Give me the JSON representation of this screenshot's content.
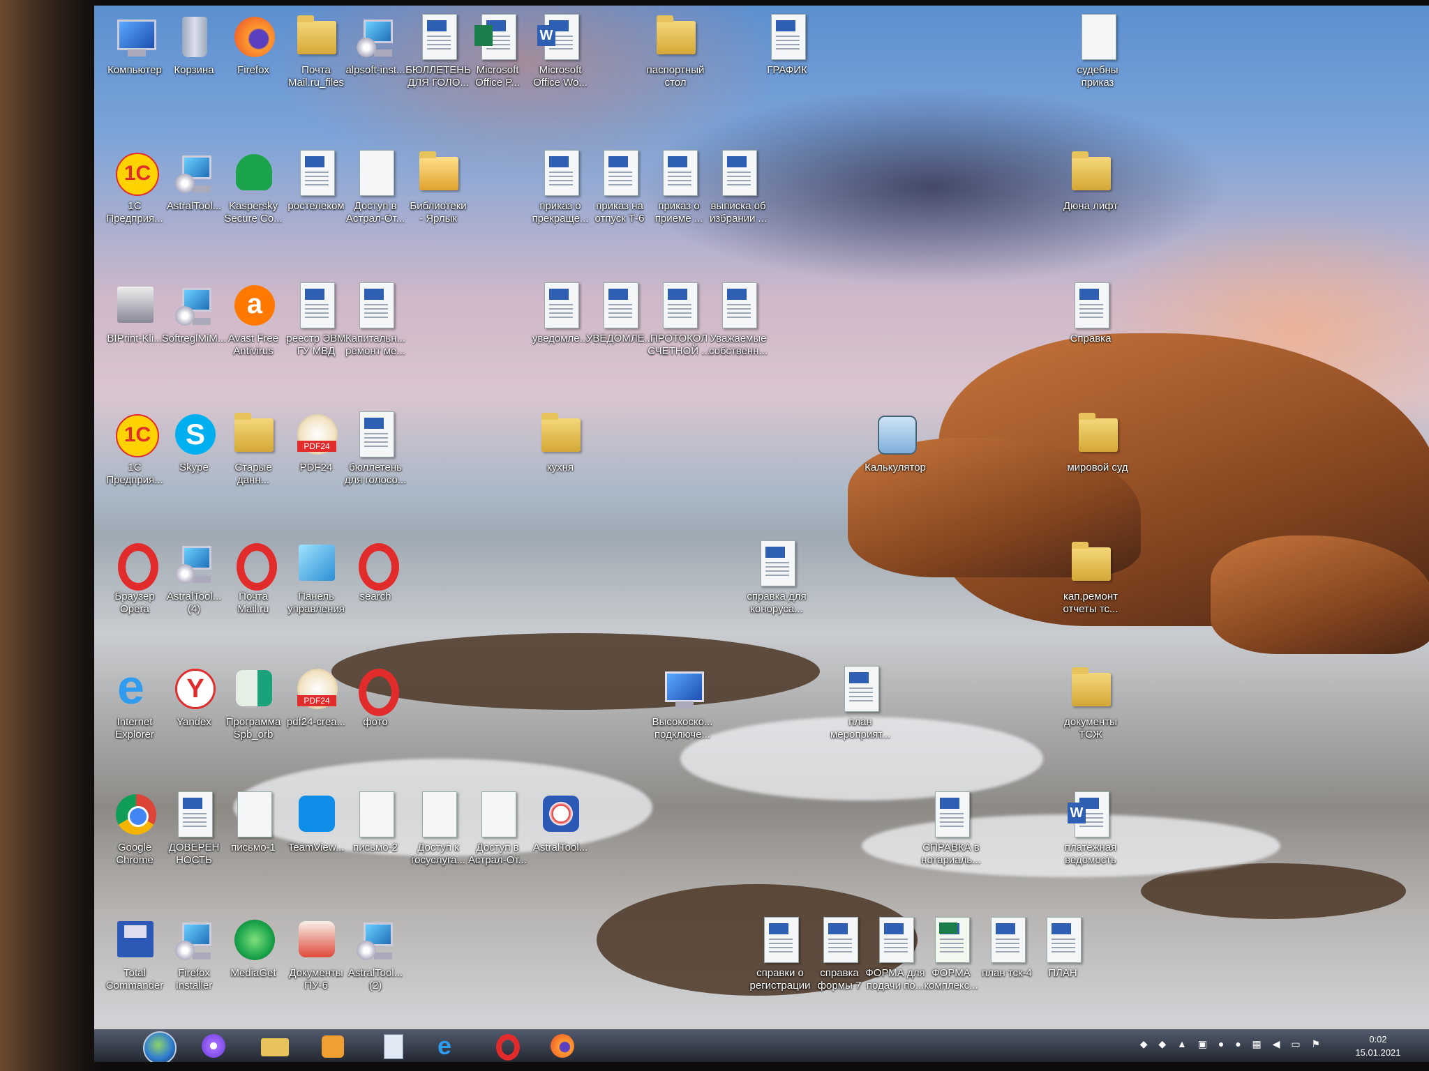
{
  "desktop_icons": [
    {
      "label": "Компьютер",
      "icon": "computer-icon"
    },
    {
      "label": "Корзина",
      "icon": "recycle-bin-icon"
    },
    {
      "label": "Firefox",
      "icon": "firefox-icon"
    },
    {
      "label": "Почта\nMail.ru_files",
      "icon": "folder-icon"
    },
    {
      "label": "alpsoft-inst...",
      "icon": "installer-icon"
    },
    {
      "label": "БЮЛЛЕТЕНЬ\nДЛЯ ГОЛО...",
      "icon": "word-doc-icon"
    },
    {
      "label": "Microsoft\nOffice P...",
      "icon": "publisher-icon"
    },
    {
      "label": "Microsoft\nOffice Wo...",
      "icon": "word-icon"
    },
    {
      "label": "паспортный\nстол",
      "icon": "folder-icon"
    },
    {
      "label": "ГРАФИК",
      "icon": "word-doc-icon"
    },
    {
      "label": "судебны\nприказ",
      "icon": "document-icon"
    },
    {
      "label": "1С\nПредприя...",
      "icon": "1c-icon"
    },
    {
      "label": "AstralTool...",
      "icon": "installer-icon"
    },
    {
      "label": "Kaspersky\nSecure Co...",
      "icon": "kaspersky-icon"
    },
    {
      "label": "ростелеком",
      "icon": "word-doc-icon"
    },
    {
      "label": "Доступ в\nАстрал-От...",
      "icon": "document-icon"
    },
    {
      "label": "Библиотеки\n- Ярлык",
      "icon": "libraries-icon"
    },
    {
      "label": "приказ о\nпрекраще...",
      "icon": "word-doc-icon"
    },
    {
      "label": "приказ на\nотпуск Т-6",
      "icon": "word-doc-icon"
    },
    {
      "label": "приказ о\nприеме ...",
      "icon": "word-doc-icon"
    },
    {
      "label": "выписка об\nизбрании ...",
      "icon": "word-doc-icon"
    },
    {
      "label": "Дюна лифт",
      "icon": "folder-icon"
    },
    {
      "label": "BIPrint-Kli...",
      "icon": "printer-icon"
    },
    {
      "label": "SoftreglMiM...",
      "icon": "installer-icon"
    },
    {
      "label": "Avast Free\nAntivirus",
      "icon": "avast-icon"
    },
    {
      "label": "реестр ЭВМ\nГУ МВД",
      "icon": "word-doc-icon"
    },
    {
      "label": "Капитальн...\nремонт ме...",
      "icon": "word-doc-icon"
    },
    {
      "label": "уведомле...",
      "icon": "word-doc-icon"
    },
    {
      "label": "УВЕДОМЛЕ...",
      "icon": "word-doc-icon"
    },
    {
      "label": "ПРОТОКОЛ\nСЧЕТНОЙ ...",
      "icon": "word-doc-icon"
    },
    {
      "label": "Уважаемые\nсобственн...",
      "icon": "word-doc-icon"
    },
    {
      "label": "Справка",
      "icon": "word-doc-icon"
    },
    {
      "label": "1С\nПредприя...",
      "icon": "1c-icon"
    },
    {
      "label": "Skype",
      "icon": "skype-icon"
    },
    {
      "label": "Старые\nданн...",
      "icon": "folder-icon"
    },
    {
      "label": "PDF24",
      "icon": "pdf24-icon"
    },
    {
      "label": "бюллетень\nдля голосо...",
      "icon": "word-doc-icon"
    },
    {
      "label": "кухня",
      "icon": "folder-icon"
    },
    {
      "label": "Калькулятор",
      "icon": "calculator-icon"
    },
    {
      "label": "мировой суд",
      "icon": "folder-icon"
    },
    {
      "label": "Браузер\nOpera",
      "icon": "opera-icon"
    },
    {
      "label": "AstralTool...\n(4)",
      "icon": "installer-icon"
    },
    {
      "label": "Почта\nMail.ru",
      "icon": "opera-icon"
    },
    {
      "label": "Панель\nуправления",
      "icon": "control-panel-icon"
    },
    {
      "label": "search",
      "icon": "opera-icon"
    },
    {
      "label": "справка для\nконоруса...",
      "icon": "word-doc-icon"
    },
    {
      "label": "кап.ремонт\nотчеты тс...",
      "icon": "folder-icon"
    },
    {
      "label": "Internet\nExplorer",
      "icon": "ie-icon"
    },
    {
      "label": "Yandex",
      "icon": "yandex-icon"
    },
    {
      "label": "Программа\nSpb_orb",
      "icon": "app-icon"
    },
    {
      "label": "pdf24-crea...",
      "icon": "pdf24-icon"
    },
    {
      "label": "фото",
      "icon": "opera-icon"
    },
    {
      "label": "Высокоско...\nподключе...",
      "icon": "network-icon"
    },
    {
      "label": "план\nмероприят...",
      "icon": "word-doc-icon"
    },
    {
      "label": "документы\nТСЖ",
      "icon": "folder-icon"
    },
    {
      "label": "Google\nChrome",
      "icon": "chrome-icon"
    },
    {
      "label": "ДОВЕРЕН\nНОСТЬ",
      "icon": "word-doc-icon"
    },
    {
      "label": "письмо-1",
      "icon": "blank-doc-icon"
    },
    {
      "label": "TeamView...",
      "icon": "teamviewer-icon"
    },
    {
      "label": "письмо-2",
      "icon": "blank-doc-icon"
    },
    {
      "label": "Доступ к\nгосуслуга...",
      "icon": "document-icon"
    },
    {
      "label": "Доступ в\nАстрал-От...",
      "icon": "document-icon"
    },
    {
      "label": "AstralTool...",
      "icon": "astral-icon"
    },
    {
      "label": "СПРАВКА в\nнотариаль...",
      "icon": "word-doc-icon"
    },
    {
      "label": "платежная\nведомость",
      "icon": "word-icon"
    },
    {
      "label": "Total\nCommander",
      "icon": "floppy-icon"
    },
    {
      "label": "Firefox\nInstaller",
      "icon": "installer-icon"
    },
    {
      "label": "MediaGet",
      "icon": "mediaget-icon"
    },
    {
      "label": "Документы\nПУ-6",
      "icon": "pfr-icon"
    },
    {
      "label": "AstralTool...\n(2)",
      "icon": "installer-icon"
    },
    {
      "label": "справки о\nрегистрации",
      "icon": "word-doc-icon"
    },
    {
      "label": "справка\nформы 7",
      "icon": "word-doc-icon"
    },
    {
      "label": "ФОРМА для\nподачи по...",
      "icon": "word-doc-icon"
    },
    {
      "label": "ФОРМА\nкомплекс...",
      "icon": "excel-doc-icon"
    },
    {
      "label": "план тск-4",
      "icon": "word-doc-icon"
    },
    {
      "label": "ПЛАН",
      "icon": "word-doc-icon"
    }
  ],
  "taskbar": {
    "start_icon": "windows-start-icon",
    "pinned": [
      {
        "icon": "alice-icon"
      },
      {
        "icon": "explorer-icon"
      },
      {
        "icon": "media-player-icon"
      },
      {
        "icon": "notepad-icon"
      },
      {
        "icon": "ie-icon"
      },
      {
        "icon": "opera-icon"
      },
      {
        "icon": "firefox-icon"
      }
    ],
    "tray_icons": [
      "avast-tray-icon",
      "kaspersky-tray-icon",
      "network-tray-icon",
      "usb-tray-icon",
      "opera-tray-icon",
      "opera-tray-icon-2",
      "update-tray-icon",
      "volume-icon",
      "display-icon",
      "flag-icon"
    ],
    "clock_time": "0:02",
    "clock_date": "15.01.2021"
  },
  "colors": {
    "word_blue": "#2f5fb3",
    "folder": "#e8c25a",
    "opera_red": "#e22b2b"
  }
}
